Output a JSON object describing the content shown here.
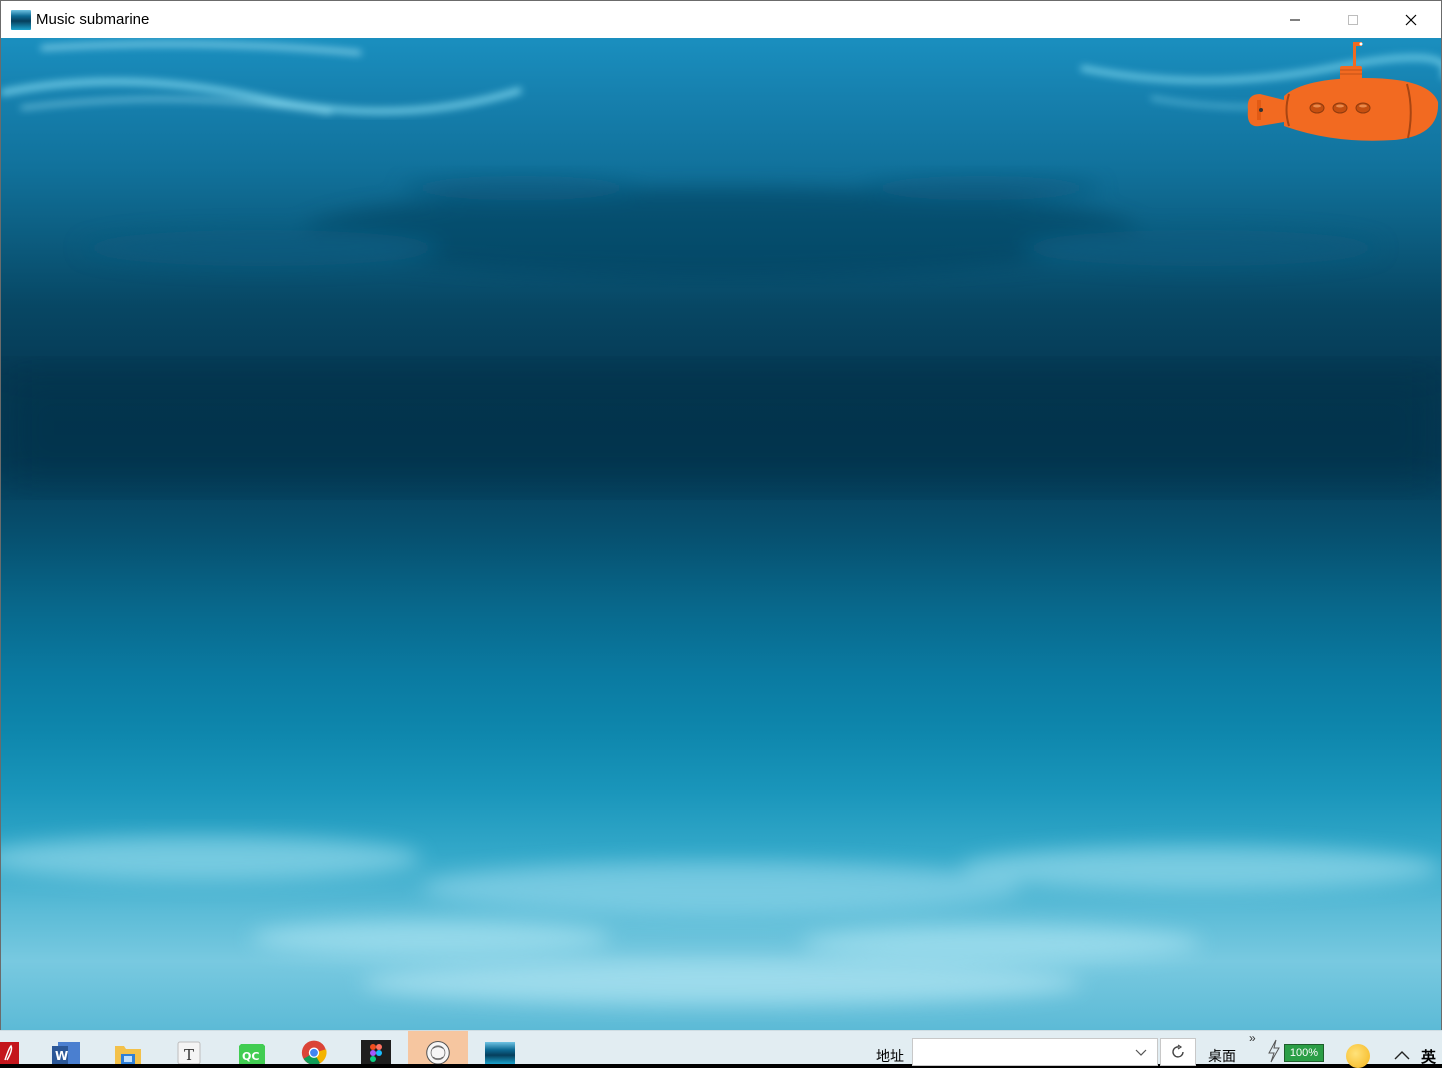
{
  "window": {
    "title": "Music submarine",
    "controls": [
      "minimize",
      "maximize",
      "close"
    ]
  },
  "scene": {
    "description_icons": [
      "submarine-icon"
    ],
    "submarine_color": "#f26a21"
  },
  "taskbar": {
    "apps": [
      {
        "name": "acrobat-icon",
        "color": "#c4161c"
      },
      {
        "name": "word-icon",
        "color": "#2b5797"
      },
      {
        "name": "file-explorer-icon",
        "color": "#f3c14a"
      },
      {
        "name": "typora-icon",
        "label": "T"
      },
      {
        "name": "qt-creator-icon",
        "label": "QC",
        "color": "#41cd52"
      },
      {
        "name": "chrome-icon"
      },
      {
        "name": "figma-icon"
      },
      {
        "name": "app-icon-active"
      },
      {
        "name": "music-submarine-taskbar-icon"
      }
    ],
    "address_label": "地址",
    "address_value": "",
    "desktop_label": "桌面",
    "battery_text": "100%",
    "ime_label": "英"
  }
}
